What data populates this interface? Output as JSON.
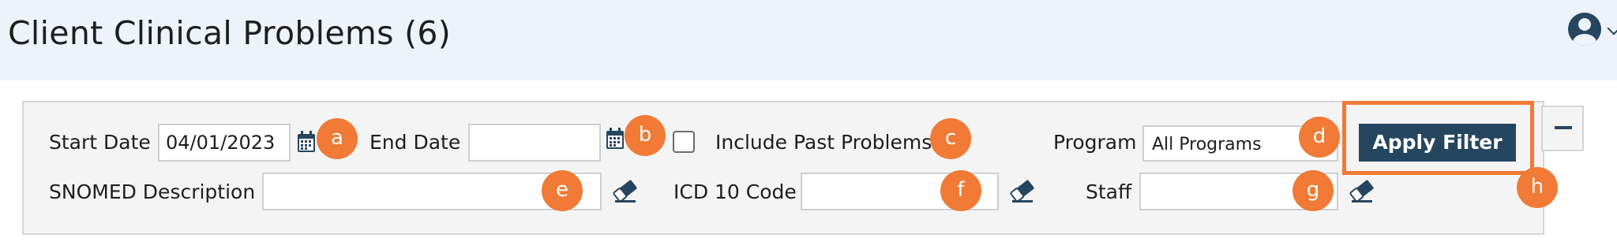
{
  "page": {
    "title": "Client Clinical Problems (6)"
  },
  "filters": {
    "start_date_label": "Start Date",
    "start_date_value": "04/01/2023",
    "end_date_label": "End Date",
    "end_date_value": "",
    "include_past_label": "Include Past Problems",
    "include_past_checked": false,
    "program_label": "Program",
    "program_value": "All Programs",
    "apply_label": "Apply Filter",
    "snomed_label": "SNOMED Description",
    "snomed_value": "",
    "icd_label": "ICD 10 Code",
    "icd_value": "",
    "staff_label": "Staff",
    "staff_value": ""
  },
  "badges": {
    "a": "a",
    "b": "b",
    "c": "c",
    "d": "d",
    "e": "e",
    "f": "f",
    "g": "g",
    "h": "h"
  },
  "icons": {
    "user": "user-icon",
    "calendar": "calendar-icon",
    "eraser": "eraser-icon",
    "collapse": "minus-icon"
  },
  "colors": {
    "header_bg": "#eef3fa",
    "accent": "#26465f",
    "badge": "#f07a36",
    "panel_bg": "#f4f4f4"
  }
}
